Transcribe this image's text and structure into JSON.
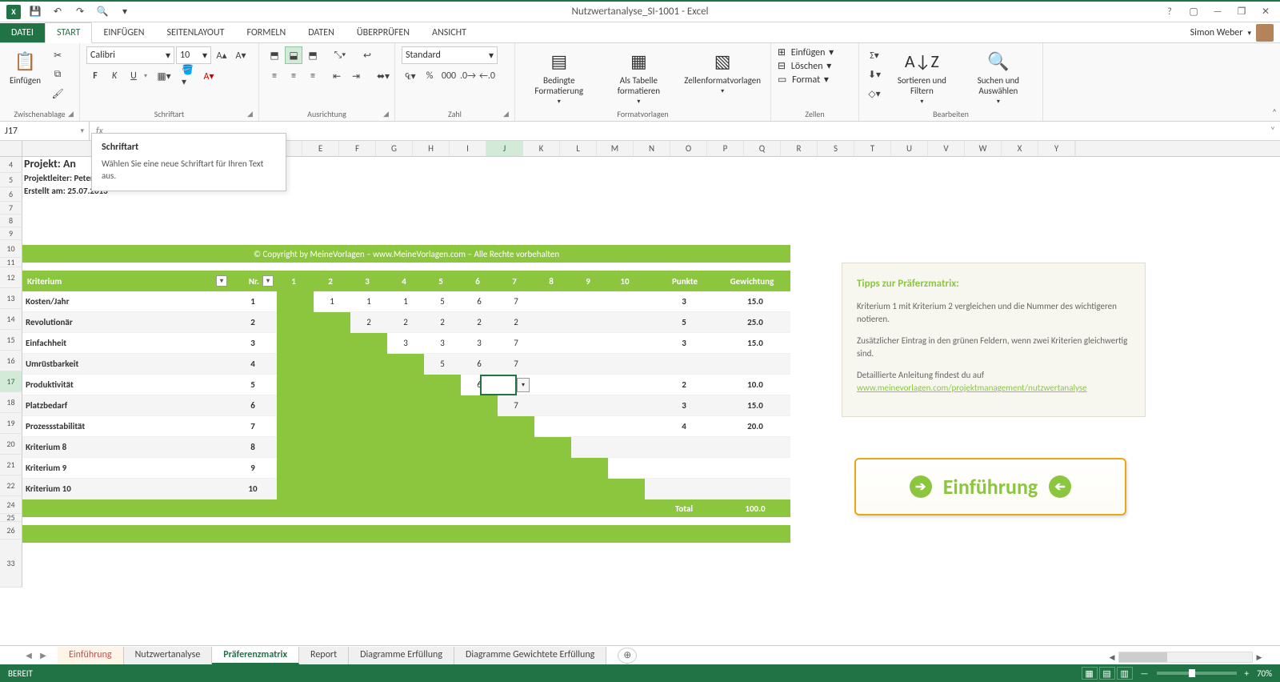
{
  "app": {
    "title": "Nutzwertanalyse_SI-1001 - Excel",
    "user": "Simon Weber"
  },
  "qat": {
    "xl": "X",
    "save": "💾",
    "undo": "↶",
    "redo": "↷",
    "touch": "🔍"
  },
  "win": {
    "help": "?",
    "ribbon_opts": "▢",
    "min": "—",
    "max": "❐",
    "close": "✕"
  },
  "tabs": {
    "datei": "DATEI",
    "start": "START",
    "einfuegen": "EINFÜGEN",
    "seitenlayout": "SEITENLAYOUT",
    "formeln": "FORMELN",
    "daten": "DATEN",
    "ueberpruefen": "ÜBERPRÜFEN",
    "ansicht": "ANSICHT"
  },
  "ribbon": {
    "clipboard": {
      "label": "Zwischenablage",
      "paste": "Einfügen"
    },
    "font": {
      "label": "Schriftart",
      "name": "Calibri",
      "size": "10",
      "bold": "F",
      "italic": "K",
      "underline": "U"
    },
    "align": {
      "label": "Ausrichtung"
    },
    "number": {
      "label": "Zahl",
      "format": "Standard"
    },
    "styles": {
      "label": "Formatvorlagen",
      "cond": "Bedingte Formatierung",
      "table": "Als Tabelle formatieren",
      "cell": "Zellenformatvorlagen"
    },
    "cells": {
      "label": "Zellen",
      "insert": "Einfügen",
      "delete": "Löschen",
      "format": "Format"
    },
    "editing": {
      "label": "Bearbeiten",
      "sort": "Sortieren und Filtern",
      "find": "Suchen und Auswählen"
    }
  },
  "tooltip": {
    "title": "Schriftart",
    "body": "Wählen Sie eine neue Schriftart für Ihren Text aus."
  },
  "namebox": "J17",
  "cols": [
    "E",
    "F",
    "G",
    "H",
    "I",
    "J",
    "K",
    "L",
    "M",
    "N",
    "O",
    "P",
    "Q",
    "R",
    "S",
    "T",
    "U",
    "V",
    "W",
    "X",
    "Y"
  ],
  "rows_left": [
    "4",
    "5",
    "6",
    "7",
    "8",
    "9",
    "10",
    "11",
    "12",
    "13",
    "14",
    "15",
    "16",
    "17",
    "18",
    "19",
    "20",
    "21",
    "22",
    "24",
    "25",
    "26",
    "33"
  ],
  "project": {
    "title": "Projekt: An",
    "leader": "Projektleiter: Peter Peter",
    "created": "Erstellt am: 25.07.2013"
  },
  "copyright": "© Copyright by MeineVorlagen – www.MeineVorlagen.com – Alle Rechte vorbehalten",
  "headers": {
    "crit": "Kriterium",
    "nr": "Nr.",
    "nums": [
      "1",
      "2",
      "3",
      "4",
      "5",
      "6",
      "7",
      "8",
      "9",
      "10"
    ],
    "pts": "Punkte",
    "wt": "Gewichtung"
  },
  "matrix": [
    {
      "label": "Kosten/Jahr",
      "nr": "1",
      "green": 1,
      "vals": [
        "",
        "1",
        "1",
        "1",
        "5",
        "6",
        "7",
        "",
        "",
        ""
      ],
      "pts": "3",
      "wt": "15.0"
    },
    {
      "label": "Revolutionär",
      "nr": "2",
      "green": 2,
      "vals": [
        "",
        "",
        "2",
        "2",
        "2",
        "2",
        "2",
        "",
        "",
        ""
      ],
      "pts": "5",
      "wt": "25.0"
    },
    {
      "label": "Einfachheit",
      "nr": "3",
      "green": 3,
      "vals": [
        "",
        "",
        "",
        "3",
        "3",
        "3",
        "7",
        "",
        "",
        ""
      ],
      "pts": "3",
      "wt": "15.0"
    },
    {
      "label": "Umrüstbarkeit",
      "nr": "4",
      "green": 4,
      "vals": [
        "",
        "",
        "",
        "",
        "5",
        "6",
        "7",
        "",
        "",
        ""
      ],
      "pts": "",
      "wt": ""
    },
    {
      "label": "Produktivität",
      "nr": "5",
      "green": 5,
      "vals": [
        "",
        "",
        "",
        "",
        "",
        "6",
        "",
        "",
        "",
        ""
      ],
      "pts": "2",
      "wt": "10.0"
    },
    {
      "label": "Platzbedarf",
      "nr": "6",
      "green": 6,
      "vals": [
        "",
        "",
        "",
        "",
        "",
        "",
        "7",
        "",
        "",
        ""
      ],
      "pts": "3",
      "wt": "15.0"
    },
    {
      "label": "Prozessstabilität",
      "nr": "7",
      "green": 7,
      "vals": [
        "",
        "",
        "",
        "",
        "",
        "",
        "",
        "",
        "",
        ""
      ],
      "pts": "4",
      "wt": "20.0"
    },
    {
      "label": "Kriterium 8",
      "nr": "8",
      "green": 8,
      "vals": [
        "",
        "",
        "",
        "",
        "",
        "",
        "",
        "",
        "",
        ""
      ],
      "pts": "",
      "wt": ""
    },
    {
      "label": "Kriterium 9",
      "nr": "9",
      "green": 9,
      "vals": [
        "",
        "",
        "",
        "",
        "",
        "",
        "",
        "",
        "",
        ""
      ],
      "pts": "",
      "wt": ""
    },
    {
      "label": "Kriterium 10",
      "nr": "10",
      "green": 10,
      "vals": [
        "",
        "",
        "",
        "",
        "",
        "",
        "",
        "",
        "",
        ""
      ],
      "pts": "",
      "wt": ""
    }
  ],
  "total": {
    "label": "Total",
    "value": "100.0"
  },
  "tips": {
    "title": "Tipps zur Präferzmatrix:",
    "p1": "Kriterium 1 mit Kriterium 2 vergleichen und die Nummer des wichtigeren notieren.",
    "p2": "Zusätzlicher Eintrag in den grünen Feldern, wenn zwei Kriterien gleichwertig sind.",
    "p3": "Detaillierte Anleitung findest du auf",
    "link": "www.meinevorlagen.com/projektmanagement/nutzwertanalyse"
  },
  "intro_btn": "Einführung",
  "sheets": [
    "Einführung",
    "Nutzwertanalyse",
    "Präferenzmatrix",
    "Report",
    "Diagramme Erfüllung",
    "Diagramme Gewichtete Erfüllung"
  ],
  "status": {
    "ready": "BEREIT",
    "zoom": "70%"
  }
}
